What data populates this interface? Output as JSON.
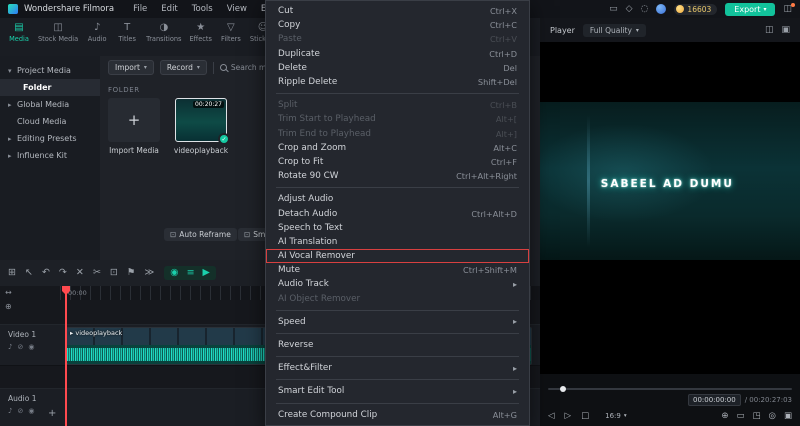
{
  "menubar": {
    "app_name": "Wondershare Filmora",
    "menus": [
      "File",
      "Edit",
      "Tools",
      "View",
      "Extended"
    ],
    "right_icons": [
      {
        "name": "display-icon",
        "glyph": "▭"
      },
      {
        "name": "voiceover-icon",
        "glyph": "◇"
      },
      {
        "name": "notifications-icon",
        "glyph": "◌"
      }
    ],
    "coins": "16603",
    "export_label": "Export"
  },
  "sidebar_tabs": [
    {
      "label": "Media",
      "icon": "▤",
      "active": true
    },
    {
      "label": "Stock Media",
      "icon": "◫"
    },
    {
      "label": "Audio",
      "icon": "♪"
    },
    {
      "label": "Titles",
      "icon": "T"
    },
    {
      "label": "Transitions",
      "icon": "◑"
    },
    {
      "label": "Effects",
      "icon": "★"
    },
    {
      "label": "Filters",
      "icon": "▽"
    },
    {
      "label": "Stickers",
      "icon": "☺"
    }
  ],
  "library_nav": [
    {
      "label": "Project Media",
      "chevron": "down"
    },
    {
      "label": "Folder",
      "indent": true,
      "active": true
    },
    {
      "label": "Global Media",
      "chevron": "right"
    },
    {
      "label": "Cloud Media"
    },
    {
      "label": "Editing Presets",
      "chevron": "right"
    },
    {
      "label": "Influence Kit",
      "chevron": "right"
    }
  ],
  "media_panel": {
    "import_label": "Import",
    "record_label": "Record",
    "search_placeholder": "Search media",
    "folder_label": "FOLDER",
    "import_tile_label": "Import Media",
    "clip_name": "videoplayback",
    "clip_duration": "00:20:27",
    "auto_reframe_label": "Auto Reframe",
    "smart_label": "Smart S"
  },
  "context_menu": {
    "items": [
      {
        "label": "Cut",
        "shortcut": "Ctrl+X"
      },
      {
        "label": "Copy",
        "shortcut": "Ctrl+C"
      },
      {
        "label": "Paste",
        "shortcut": "Ctrl+V",
        "disabled": true
      },
      {
        "label": "Duplicate",
        "shortcut": "Ctrl+D"
      },
      {
        "label": "Delete",
        "shortcut": "Del"
      },
      {
        "label": "Ripple Delete",
        "shortcut": "Shift+Del"
      },
      {
        "divider": true
      },
      {
        "label": "Split",
        "shortcut": "Ctrl+B",
        "disabled": true
      },
      {
        "label": "Trim Start to Playhead",
        "shortcut": "Alt+[",
        "disabled": true
      },
      {
        "label": "Trim End to Playhead",
        "shortcut": "Alt+]",
        "disabled": true
      },
      {
        "label": "Crop and Zoom",
        "shortcut": "Alt+C"
      },
      {
        "label": "Crop to Fit",
        "shortcut": "Ctrl+F"
      },
      {
        "label": "Rotate 90 CW",
        "shortcut": "Ctrl+Alt+Right"
      },
      {
        "divider": true
      },
      {
        "label": "Adjust Audio"
      },
      {
        "label": "Detach Audio",
        "shortcut": "Ctrl+Alt+D"
      },
      {
        "label": "Speech to Text"
      },
      {
        "label": "AI Translation"
      },
      {
        "label": "AI Vocal Remover",
        "highlighted": true
      },
      {
        "label": "Mute",
        "shortcut": "Ctrl+Shift+M"
      },
      {
        "label": "Audio Track",
        "submenu": true
      },
      {
        "label": "AI Object Remover",
        "disabled": true
      },
      {
        "divider": true
      },
      {
        "label": "Speed",
        "submenu": true
      },
      {
        "divider": true
      },
      {
        "label": "Reverse"
      },
      {
        "divider": true
      },
      {
        "label": "Effect&Filter",
        "submenu": true
      },
      {
        "divider": true
      },
      {
        "label": "Smart Edit Tool",
        "submenu": true
      },
      {
        "divider": true
      },
      {
        "label": "Create Compound Clip",
        "shortcut": "Alt+G"
      }
    ]
  },
  "timeline": {
    "ruler_label": "00:00",
    "clip_label": "videoplayback",
    "tracks": [
      {
        "name": "Video 1"
      },
      {
        "name": "Audio 1"
      }
    ],
    "toolbar_icons": [
      {
        "name": "media-bin-icon",
        "glyph": "⊞"
      },
      {
        "name": "pointer-icon",
        "glyph": "↖"
      },
      {
        "name": "undo-icon",
        "glyph": "↶"
      },
      {
        "name": "redo-icon",
        "glyph": "↷"
      },
      {
        "name": "delete-icon",
        "glyph": "✕"
      },
      {
        "name": "scissors-icon",
        "glyph": "✂"
      },
      {
        "name": "crop-icon",
        "glyph": "⊡"
      },
      {
        "name": "marker-icon",
        "glyph": "⚑"
      },
      {
        "name": "more-tools-icon",
        "glyph": "≫"
      }
    ],
    "accent_icons": [
      {
        "name": "voiceover-record-icon",
        "glyph": "◉"
      },
      {
        "name": "audio-mixer-icon",
        "glyph": "≡"
      },
      {
        "name": "render-preview-icon",
        "glyph": "▶"
      }
    ],
    "track_icons": [
      {
        "name": "track-mute-icon",
        "glyph": "♪"
      },
      {
        "name": "track-lock-icon",
        "glyph": "⊘"
      },
      {
        "name": "track-visibility-icon",
        "glyph": "◉"
      }
    ]
  },
  "player": {
    "title": "Player",
    "quality": "Full Quality",
    "overlay_text": "SABEEL AD DUMU",
    "timecode_current": "00:00:00:00",
    "timecode_total": "/ 00:20:27:03",
    "ratio_label": "16:9",
    "head_icons": [
      {
        "name": "dual-preview-icon",
        "glyph": "◫"
      },
      {
        "name": "preview-mode-icon",
        "glyph": "▣"
      }
    ],
    "controls": {
      "transport": [
        {
          "name": "previous-frame-icon",
          "glyph": "◁"
        },
        {
          "name": "play-icon",
          "glyph": "▷"
        },
        {
          "name": "stop-icon",
          "glyph": "□"
        }
      ],
      "right_icons": [
        {
          "name": "zoom-icon",
          "glyph": "⊕"
        },
        {
          "name": "fit-screen-icon",
          "glyph": "▭"
        },
        {
          "name": "pip-icon",
          "glyph": "◳"
        },
        {
          "name": "snapshot-icon",
          "glyph": "◎"
        },
        {
          "name": "fullscreen-icon",
          "glyph": "▣"
        }
      ]
    }
  }
}
